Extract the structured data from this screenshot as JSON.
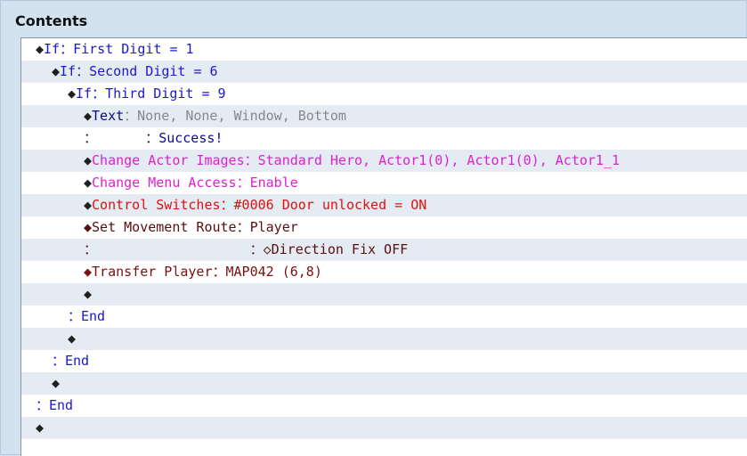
{
  "panel": {
    "title": "Contents"
  },
  "colors": {
    "blue": "#1a1acc",
    "dark": "#202020",
    "gray": "#888888",
    "navy": "#0a0a8c",
    "magenta": "#e020d0",
    "red": "#e01010",
    "brown": "#5a0f0f",
    "darkred": "#7a1010"
  },
  "rows": [
    {
      "indent": 0,
      "segments": [
        {
          "t": "◆",
          "c": "dark"
        },
        {
          "t": "If：First Digit = 1",
          "c": "blue"
        }
      ]
    },
    {
      "indent": 1,
      "segments": [
        {
          "t": "◆",
          "c": "dark"
        },
        {
          "t": "If：Second Digit = 6",
          "c": "blue"
        }
      ]
    },
    {
      "indent": 2,
      "segments": [
        {
          "t": "◆",
          "c": "dark"
        },
        {
          "t": "If：Third Digit = 9",
          "c": "blue"
        }
      ]
    },
    {
      "indent": 3,
      "segments": [
        {
          "t": "◆",
          "c": "dark"
        },
        {
          "t": "Text",
          "c": "navy"
        },
        {
          "t": "：None, None, Window, Bottom",
          "c": "gray"
        }
      ]
    },
    {
      "indent": 3,
      "segments": [
        {
          "t": "：      ：",
          "c": "dark"
        },
        {
          "t": "Success!",
          "c": "navy"
        }
      ]
    },
    {
      "indent": 3,
      "segments": [
        {
          "t": "◆",
          "c": "dark"
        },
        {
          "t": "Change Actor Images：Standard Hero, Actor1(0), Actor1(0), Actor1_1",
          "c": "magenta"
        }
      ]
    },
    {
      "indent": 3,
      "segments": [
        {
          "t": "◆",
          "c": "dark"
        },
        {
          "t": "Change Menu Access：Enable",
          "c": "magenta"
        }
      ]
    },
    {
      "indent": 3,
      "segments": [
        {
          "t": "◆",
          "c": "dark"
        },
        {
          "t": "Control Switches：#0006 Door unlocked = ON",
          "c": "red"
        }
      ]
    },
    {
      "indent": 3,
      "segments": [
        {
          "t": "◆Set Movement Route：Player",
          "c": "brown"
        }
      ]
    },
    {
      "indent": 3,
      "segments": [
        {
          "t": "：                   ：◇Direction Fix OFF",
          "c": "brown"
        }
      ]
    },
    {
      "indent": 3,
      "segments": [
        {
          "t": "◆Transfer Player：MAP042 (6,8)",
          "c": "darkred"
        }
      ]
    },
    {
      "indent": 3,
      "segments": [
        {
          "t": "◆",
          "c": "dark"
        }
      ]
    },
    {
      "indent": 2,
      "segments": [
        {
          "t": "：End",
          "c": "blue"
        }
      ]
    },
    {
      "indent": 2,
      "segments": [
        {
          "t": "◆",
          "c": "dark"
        }
      ]
    },
    {
      "indent": 1,
      "segments": [
        {
          "t": "：End",
          "c": "blue"
        }
      ]
    },
    {
      "indent": 1,
      "segments": [
        {
          "t": "◆",
          "c": "dark"
        }
      ]
    },
    {
      "indent": 0,
      "segments": [
        {
          "t": "：End",
          "c": "blue"
        }
      ]
    },
    {
      "indent": 0,
      "segments": [
        {
          "t": "◆",
          "c": "dark"
        }
      ]
    }
  ]
}
